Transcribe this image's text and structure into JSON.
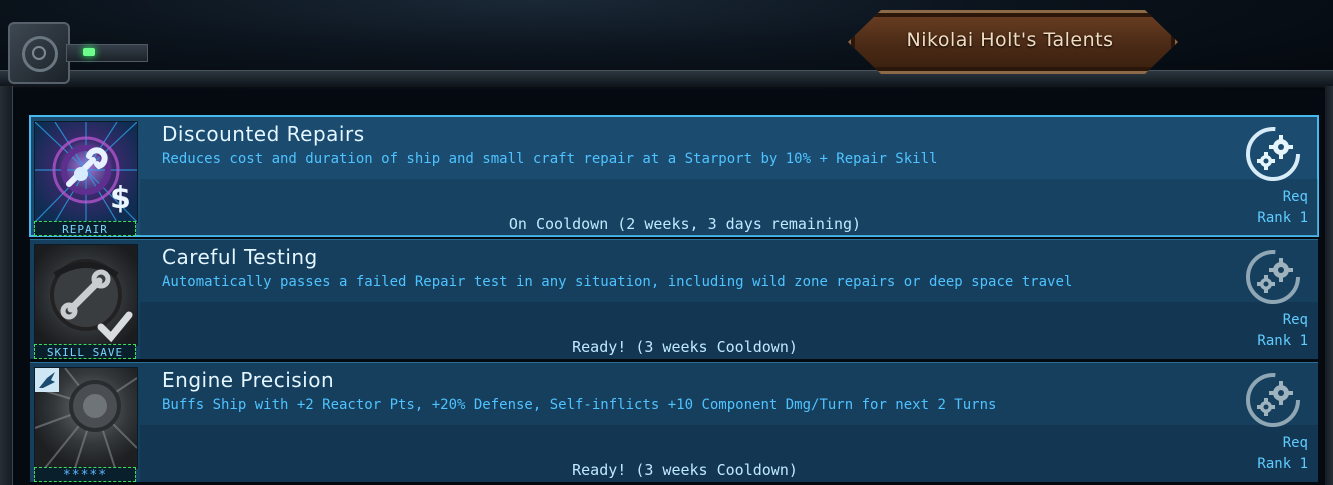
{
  "window": {
    "title": "Nikolai Holt's Talents"
  },
  "talents": [
    {
      "name": "Discounted Repairs",
      "description": "Reduces cost and duration of ship and small craft repair at a Starport by 10% + Repair Skill",
      "status": "On Cooldown (2 weeks, 3 days remaining)",
      "tag": "REPAIR",
      "icon": "repair-wrench-dollar-icon",
      "req_label": "Req",
      "rank_label": "Rank 1",
      "selected": true
    },
    {
      "name": "Careful Testing",
      "description": "Automatically passes a failed Repair test in any situation, including wild zone repairs or deep space travel",
      "status": "Ready! (3 weeks Cooldown)",
      "tag": "SKILL SAVE",
      "icon": "wrench-check-icon",
      "req_label": "Req",
      "rank_label": "Rank 1",
      "selected": false
    },
    {
      "name": "Engine Precision",
      "description": "Buffs Ship with +2 Reactor Pts, +20% Defense, Self-inflicts +10 Component Dmg/Turn for next 2 Turns",
      "status": "Ready! (3 weeks Cooldown)",
      "tag": "*****",
      "icon": "engine-thruster-icon",
      "req_label": "Req",
      "rank_label": "Rank 1",
      "selected": false
    }
  ],
  "colors": {
    "accent": "#48b9ee",
    "description": "#4fc3ff",
    "title_plate": "#5a341c",
    "led": "#6cff8c"
  }
}
